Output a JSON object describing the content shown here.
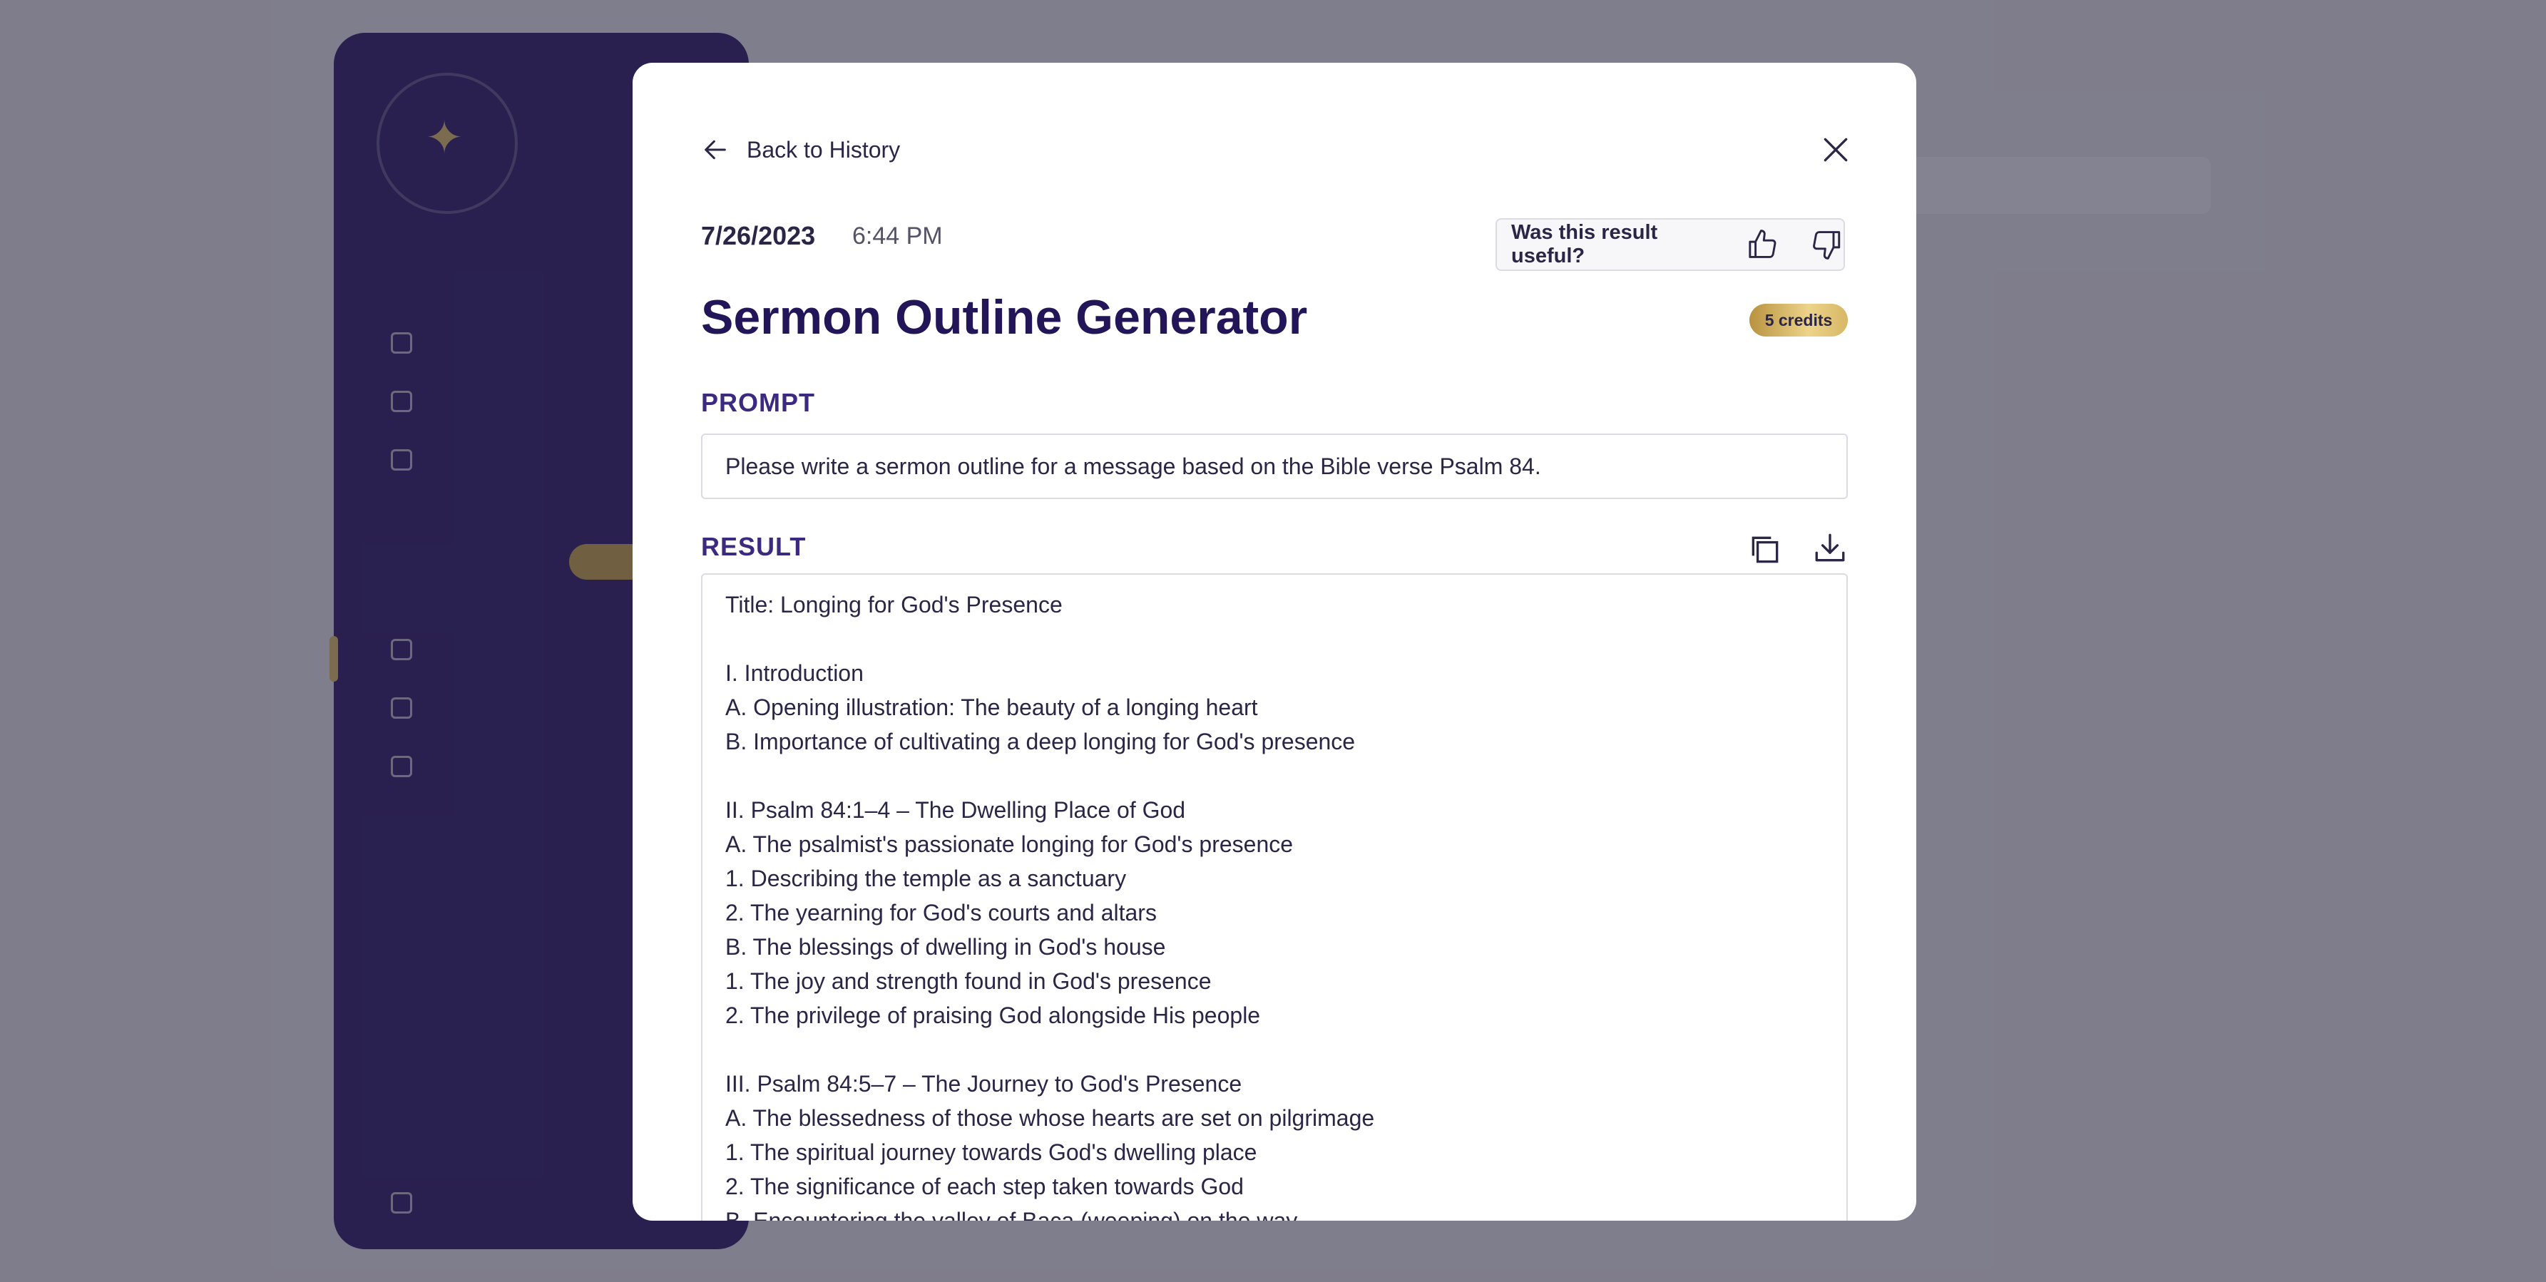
{
  "background": {
    "logo_lines": [
      "",
      ""
    ],
    "sidebar_sections": [
      "",
      ""
    ],
    "sidebar_items": [
      "",
      "",
      "",
      "",
      "",
      "",
      ""
    ],
    "link": ""
  },
  "modal": {
    "back_label": "Back to History",
    "date": "7/26/2023",
    "time": "6:44 PM",
    "feedback_question": "Was this result useful?",
    "title": "Sermon Outline Generator",
    "credits_badge": "5 credits",
    "prompt_label": "PROMPT",
    "prompt_text": "Please write a sermon outline for a message based on the Bible verse Psalm 84.",
    "result_label": "RESULT",
    "result_lines": [
      "Title: Longing for God's Presence",
      "",
      "I. Introduction",
      "A. Opening illustration: The beauty of a longing heart",
      "B. Importance of cultivating a deep longing for God's presence",
      "",
      "II. Psalm 84:1–4 – The Dwelling Place of God",
      "A. The psalmist's passionate longing for God's presence",
      "1. Describing the temple as a sanctuary",
      "2. The yearning for God's courts and altars",
      "B. The blessings of dwelling in God's house",
      "1. The joy and strength found in God's presence",
      "2. The privilege of praising God alongside His people",
      "",
      "III. Psalm 84:5–7 – The Journey to God's Presence",
      "A. The blessedness of those whose hearts are set on pilgrimage",
      "1. The spiritual journey towards God's dwelling place",
      "2. The significance of each step taken towards God",
      "B. Encountering the valley of Baca (weeping) on the way"
    ]
  },
  "colors": {
    "title": "#221558",
    "label": "#3b2a80",
    "text": "#2b2546",
    "badge_gold": "#d7b766",
    "sidebar": "#2a1a66"
  }
}
